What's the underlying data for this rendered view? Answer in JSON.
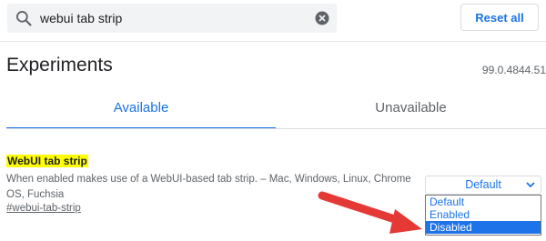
{
  "search": {
    "value": "webui tab strip",
    "icon": "search-icon",
    "clear_icon": "clear-icon"
  },
  "toolbar": {
    "reset_label": "Reset all"
  },
  "header": {
    "title": "Experiments",
    "version": "99.0.4844.51"
  },
  "tabs": [
    {
      "label": "Available",
      "active": true
    },
    {
      "label": "Unavailable",
      "active": false
    }
  ],
  "experiment": {
    "title": "WebUI tab strip",
    "description": "When enabled makes use of a WebUI-based tab strip. – Mac, Windows, Linux, Chrome OS, Fuchsia",
    "link": "#webui-tab-strip",
    "select_value": "Default",
    "options": [
      {
        "label": "Default",
        "selected": false
      },
      {
        "label": "Enabled",
        "selected": false
      },
      {
        "label": "Disabled",
        "selected": true
      }
    ]
  },
  "colors": {
    "accent": "#1a73e8",
    "highlight": "#ffff00",
    "annotation_arrow": "#e53935"
  }
}
